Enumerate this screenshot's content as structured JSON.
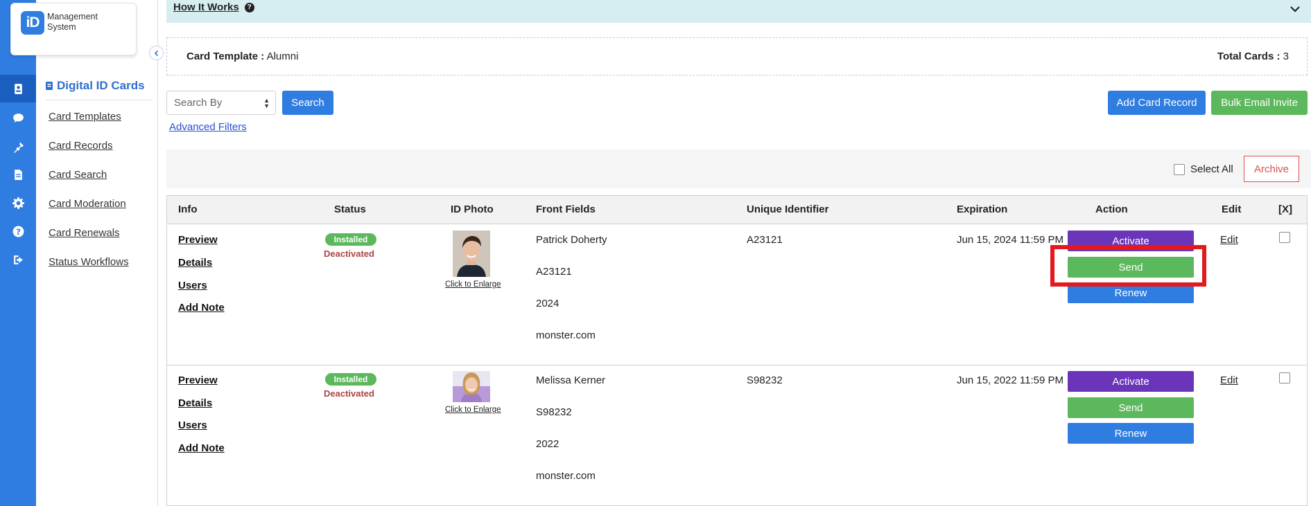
{
  "logo": {
    "badge": "iD",
    "line1": "Management",
    "line2": "System"
  },
  "rail": {
    "icons": [
      "id-card-icon",
      "chat-icon",
      "plugin-icon",
      "document-icon",
      "gear-icon",
      "help-icon",
      "logout-icon"
    ]
  },
  "subnav": {
    "title": "Digital ID Cards",
    "items": [
      {
        "label": "Card Templates"
      },
      {
        "label": "Card Records"
      },
      {
        "label": "Card Search"
      },
      {
        "label": "Card Moderation"
      },
      {
        "label": "Card Renewals"
      },
      {
        "label": "Status Workflows"
      }
    ]
  },
  "how_it_works": {
    "label": "How It Works",
    "help_glyph": "?"
  },
  "template": {
    "label": "Card Template :",
    "value": "Alumni",
    "total_label": "Total Cards :",
    "total_value": "3"
  },
  "search": {
    "select_placeholder": "Search By",
    "button": "Search",
    "advanced_filters": "Advanced Filters"
  },
  "toolbar": {
    "add_card_record": "Add Card Record",
    "bulk_email_invite": "Bulk Email Invite",
    "select_all": "Select All",
    "archive": "Archive"
  },
  "table": {
    "columns": [
      "Info",
      "Status",
      "ID Photo",
      "Front Fields",
      "Unique Identifier",
      "Expiration",
      "Action",
      "Edit",
      "[X]"
    ],
    "rows": [
      {
        "info_links": [
          "Preview",
          "Details",
          "Users",
          "Add Note"
        ],
        "status_badge": "Installed",
        "status_text": "Deactivated",
        "photo_caption": "Click to Enlarge",
        "front_fields": [
          "Patrick Doherty",
          "A23121",
          "2024",
          "monster.com"
        ],
        "unique_identifier": "A23121",
        "expiration": "Jun 15, 2024 11:59 PM",
        "actions": [
          "Activate",
          "Send",
          "Renew"
        ],
        "edit": "Edit"
      },
      {
        "info_links": [
          "Preview",
          "Details",
          "Users",
          "Add Note"
        ],
        "status_badge": "Installed",
        "status_text": "Deactivated",
        "photo_caption": "Click to Enlarge",
        "front_fields": [
          "Melissa Kerner",
          "S98232",
          "2022",
          "monster.com"
        ],
        "unique_identifier": "S98232",
        "expiration": "Jun 15, 2022 11:59 PM",
        "actions": [
          "Activate",
          "Send",
          "Renew"
        ],
        "edit": "Edit"
      }
    ]
  },
  "colors": {
    "primary_blue": "#2f7de1",
    "green": "#5cb85c",
    "purple": "#6a35b8",
    "danger": "#d9534f",
    "highlight": "#e3191e"
  }
}
